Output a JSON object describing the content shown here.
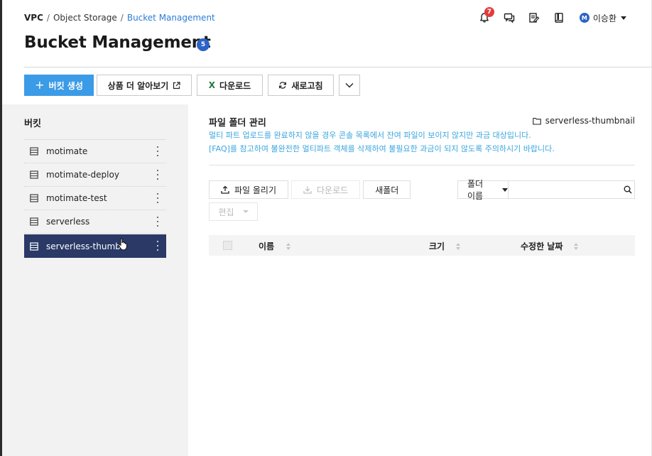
{
  "breadcrumb": {
    "items": [
      "VPC",
      "Object Storage",
      "Bucket Management"
    ],
    "separator": "/"
  },
  "header": {
    "notification_count": "7",
    "icons": [
      "bell-icon",
      "chat-icon",
      "memo-icon",
      "book-icon"
    ],
    "user": {
      "avatar_letter": "M",
      "name": "이승환"
    }
  },
  "page": {
    "title": "Bucket Management",
    "badge": "5"
  },
  "toolbar": {
    "create_label": "버킷 생성",
    "learn_more_label": "상품 더 알아보기",
    "download_label": "다운로드",
    "refresh_label": "새로고침"
  },
  "sidebar": {
    "title": "버킷",
    "items": [
      {
        "label": "motimate",
        "active": false
      },
      {
        "label": "motimate-deploy",
        "active": false
      },
      {
        "label": "motimate-test",
        "active": false
      },
      {
        "label": "serverless",
        "active": false
      },
      {
        "label": "serverless-thumbnail",
        "active": true
      }
    ]
  },
  "main": {
    "title": "파일 폴더 관리",
    "current_folder": "serverless-thumbnail",
    "info_line_1": "멀티 파트 업로드를 완료하지 않을 경우 콘솔 목록에서 잔여 파일이 보이지 않지만 과금 대상입니다.",
    "info_line_2": "[FAQ]를 참고하여 불완전한 멀티파트 객체를 삭제하여 불필요한 과금이 되지 않도록 주의하시기 바랍니다.",
    "upload_label": "파일 올리기",
    "download_label": "다운로드",
    "new_folder_label": "새폴더",
    "edit_label": "편집",
    "search": {
      "filter_label": "폴더 이름",
      "value": ""
    },
    "table": {
      "columns": [
        "이름",
        "크기",
        "수정한 날짜"
      ],
      "rows": []
    }
  },
  "colors": {
    "primary_button": "#3b9be6",
    "active_item_bg": "#2a3966",
    "info_text": "#3aa6df",
    "badge": "#2d63c8",
    "notification_badge": "#e23c3c"
  }
}
